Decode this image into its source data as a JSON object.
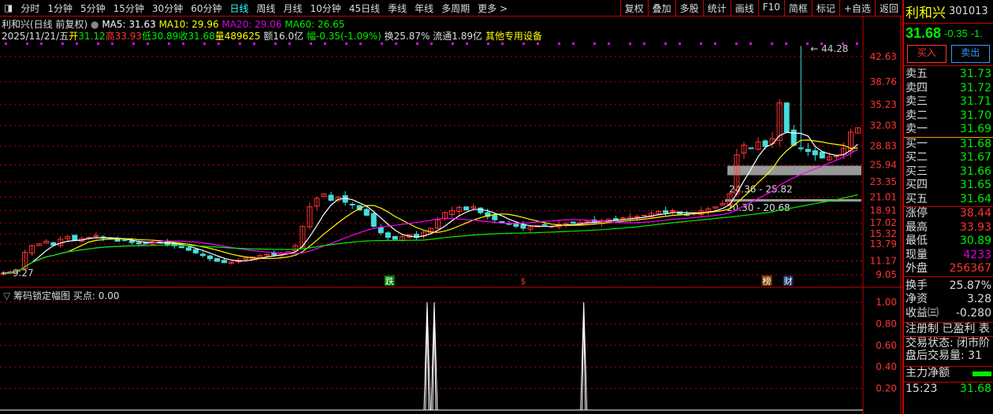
{
  "toolbar": {
    "periods": [
      "分时",
      "1分钟",
      "5分钟",
      "15分钟",
      "30分钟",
      "60分钟",
      "日线",
      "周线",
      "月线",
      "10分钟",
      "45日线",
      "季线",
      "年线",
      "多周期",
      "更多 >"
    ],
    "active": "日线",
    "tools": [
      "复权",
      "叠加",
      "多股",
      "统计",
      "画线",
      "F10",
      "简框",
      "标记",
      "+自选",
      "返回"
    ]
  },
  "header": {
    "title": "利和兴(日线 前复权)",
    "ma5": "MA5: 31.63",
    "ma10": "MA10: 29.96",
    "ma20": "MA20: 29.06",
    "ma60": "MA60: 26.65",
    "date": "2025/11/21/五",
    "open_l": "开",
    "open": "31.12",
    "high_l": "高",
    "high": "33.93",
    "low_l": "低",
    "low": "30.89",
    "close_l": "收",
    "close": "31.68",
    "vol_l": "量",
    "vol": "489625",
    "amt": "额16.0亿",
    "chg_l": "幅",
    "chg": "-0.35(-1.09%)",
    "turn": "换25.87%",
    "float": "流通1.89亿",
    "other": "其他专用设备"
  },
  "colors": {
    "up": "#ff3333",
    "down": "#44dddd",
    "ma5": "#ffffff",
    "ma10": "#ffff00",
    "ma20": "#ff00ff",
    "ma60": "#00ee00",
    "grid": "#c00000"
  },
  "chart_data": {
    "type": "candlestick",
    "yticks": [
      42.63,
      38.76,
      35.23,
      32.03,
      28.83,
      25.94,
      23.35,
      21.01,
      18.91,
      17.02,
      15.32,
      13.79,
      11.17,
      9.05
    ],
    "ylim": [
      7.35,
      47.7
    ],
    "closes": [
      9.3,
      9.5,
      9.8,
      12.5,
      13.5,
      13.8,
      14.2,
      13.6,
      14.5,
      14.9,
      14.3,
      14.6,
      14.8,
      15.1,
      14.7,
      14.5,
      14.2,
      14.4,
      14.0,
      13.8,
      13.9,
      14.1,
      14.0,
      13.7,
      13.5,
      13.2,
      12.8,
      12.4,
      12.0,
      11.5,
      11.1,
      10.9,
      11.0,
      11.3,
      11.6,
      11.8,
      12.0,
      12.2,
      12.1,
      12.4,
      12.6,
      13.5,
      16.5,
      19.5,
      20.8,
      21.5,
      20.5,
      21.0,
      20.2,
      19.8,
      19.0,
      18.2,
      16.5,
      15.5,
      14.8,
      14.5,
      14.9,
      15.2,
      14.8,
      15.6,
      16.2,
      17.5,
      18.6,
      18.9,
      19.4,
      19.0,
      19.5,
      18.6,
      18.0,
      17.5,
      17.0,
      16.8,
      16.5,
      16.2,
      16.4,
      16.6,
      16.7,
      16.5,
      16.8,
      16.9,
      17.0,
      17.1,
      17.3,
      17.2,
      17.4,
      17.6,
      17.5,
      17.8,
      17.9,
      18.0,
      18.2,
      18.5,
      18.8,
      18.6,
      18.9,
      18.4,
      18.2,
      18.6,
      18.9,
      19.2,
      19.5,
      20.0,
      21.5,
      27.5,
      29.0,
      28.5,
      29.5,
      28.8,
      30.0,
      35.5,
      31.0,
      29.0,
      28.5,
      28.0,
      27.5,
      27.0,
      27.2,
      27.3,
      28.5,
      31.0,
      31.68
    ],
    "max_label": "44.28",
    "min_label": "9.27",
    "max_value": 44.28,
    "zones": [
      {
        "label": "24.36 - 25.82",
        "low": 24.36,
        "high": 25.82
      },
      {
        "label": "20.30 - 20.68",
        "low": 20.3,
        "high": 20.68
      }
    ],
    "markers": [
      {
        "text": "跌",
        "bar": 54,
        "bg": "#008000"
      },
      {
        "text": "$",
        "bar": 73,
        "bg": "#000"
      },
      {
        "text": "榜",
        "bar": 107,
        "bg": "#804000"
      },
      {
        "text": "财",
        "bar": 110,
        "bg": "#103060"
      }
    ]
  },
  "indicator": {
    "title": "筹码锁定幅图",
    "buy": "买点: 0.00",
    "yticks": [
      "1.00",
      "0.80",
      "0.60",
      "0.40",
      "0.20"
    ],
    "spikes": [
      60,
      61,
      82
    ]
  },
  "quote": {
    "name": "利和兴",
    "code": "301013",
    "price": "31.68",
    "chg": "-0.35",
    "pct": "-1.",
    "buy_btn": "买入",
    "sell_btn": "卖出",
    "asks": [
      [
        "卖五",
        "31.73"
      ],
      [
        "卖四",
        "31.72"
      ],
      [
        "卖三",
        "31.71"
      ],
      [
        "卖二",
        "31.70"
      ],
      [
        "卖一",
        "31.69"
      ]
    ],
    "bids": [
      [
        "买一",
        "31.68"
      ],
      [
        "买二",
        "31.67"
      ],
      [
        "买三",
        "31.66"
      ],
      [
        "买四",
        "31.65"
      ],
      [
        "买五",
        "31.64"
      ]
    ],
    "stats": [
      [
        "涨停",
        "38.44",
        "r"
      ],
      [
        "最高",
        "33.93",
        "r"
      ],
      [
        "最低",
        "30.89",
        "g"
      ],
      [
        "现量",
        "4233",
        "m"
      ],
      [
        "外盘",
        "256367",
        "r"
      ]
    ],
    "stats2": [
      [
        "换手",
        "25.87%"
      ],
      [
        "净资",
        "3.28"
      ],
      [
        "收益㈢",
        "-0.280"
      ]
    ],
    "tags": "注册制 已盈利 表",
    "status": "交易状态: 闭市阶",
    "after": "盘后交易量: 31",
    "flow": "主力净额",
    "time": "15:23",
    "last": "31.68"
  }
}
